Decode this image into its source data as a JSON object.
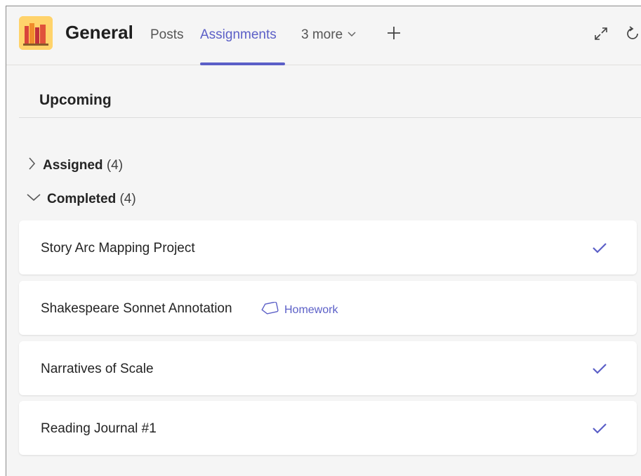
{
  "header": {
    "team_name": "General",
    "tabs": [
      {
        "label": "Posts",
        "active": false
      },
      {
        "label": "Assignments",
        "active": true
      }
    ],
    "more_label": "3 more",
    "accent_color": "#5b5fc7"
  },
  "section": {
    "title": "Upcoming"
  },
  "groups": {
    "assigned": {
      "name": "Assigned",
      "count": "(4)",
      "expanded": false
    },
    "completed": {
      "name": "Completed",
      "count": "(4)",
      "expanded": true
    }
  },
  "assignments": [
    {
      "title": "Story Arc Mapping Project",
      "completed_icon": "check-icon",
      "tag": ""
    },
    {
      "title": "Shakespeare Sonnet Annotation",
      "completed_icon": "",
      "tag": "Homework"
    },
    {
      "title": "Narratives of Scale",
      "completed_icon": "check-icon",
      "tag": ""
    },
    {
      "title": "Reading Journal #1",
      "completed_icon": "check-icon",
      "tag": ""
    }
  ]
}
